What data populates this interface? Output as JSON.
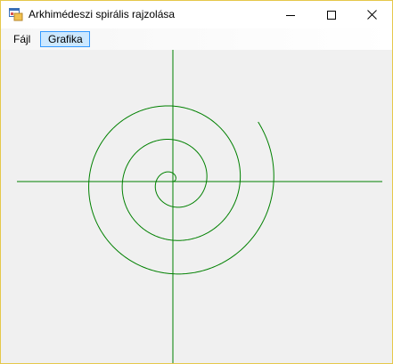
{
  "window": {
    "title": "Arkhimédeszi spirális rajzolása",
    "icon": "windows-form-app-icon",
    "controls": {
      "minimize_icon": "minimize-icon",
      "maximize_icon": "maximize-icon",
      "close_icon": "close-icon"
    }
  },
  "menu": {
    "items": [
      {
        "label": "Fájl",
        "active": false
      },
      {
        "label": "Grafika",
        "active": true
      }
    ]
  },
  "drawing": {
    "shape": "archimedean-spiral",
    "axes": "horizontal-and-vertical",
    "stroke_color": "#008000",
    "background_color": "#f0f0f0"
  }
}
